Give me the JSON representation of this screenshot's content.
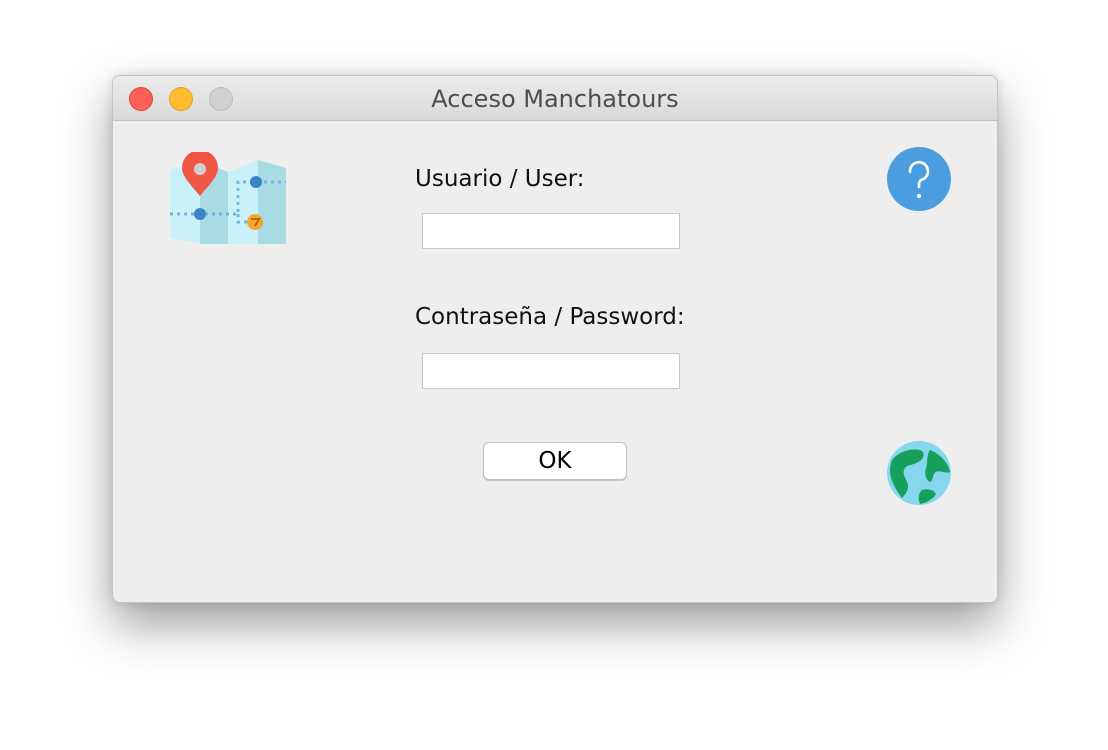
{
  "window": {
    "title": "Acceso Manchatours"
  },
  "form": {
    "user_label": "Usuario / User:",
    "user_value": "",
    "password_label": "Contraseña / Password:",
    "password_value": "",
    "ok_label": "OK"
  },
  "icons": {
    "logo": "folded-map-with-location-pin-icon",
    "help": "question-mark-circle-icon",
    "language": "globe-icon"
  },
  "colors": {
    "close": "#fe5f57",
    "minimize": "#febc2e",
    "zoom": "#d0d0d0",
    "help_blue": "#4a9ee0",
    "pin_red": "#f05545"
  }
}
